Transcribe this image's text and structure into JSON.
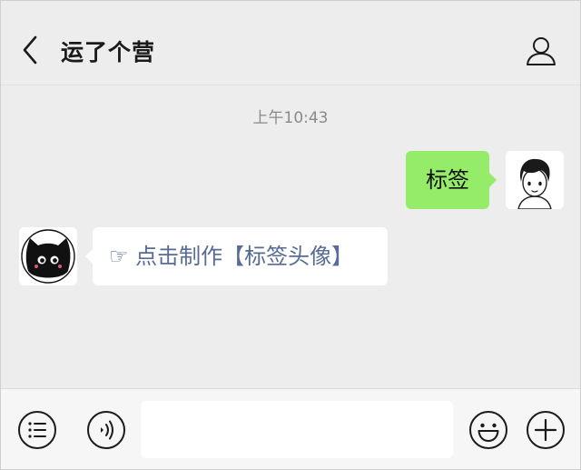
{
  "header": {
    "title": "运了个营",
    "back_icon": "chevron-left-icon",
    "profile_icon": "person-icon"
  },
  "chat": {
    "timestamp": "上午10:43",
    "messages": [
      {
        "sender": "self",
        "text": "标签",
        "bubble_color": "#95ec69"
      },
      {
        "sender": "other",
        "text": "☞ 点击制作【标签头像】",
        "link_color": "#576b95"
      }
    ]
  },
  "input_bar": {
    "menu_icon": "list-menu-icon",
    "voice_icon": "voice-icon",
    "emoji_icon": "smiley-icon",
    "plus_icon": "plus-icon",
    "input_value": ""
  },
  "colors": {
    "background": "#ededed",
    "self_bubble": "#95ec69",
    "link": "#576b95"
  }
}
